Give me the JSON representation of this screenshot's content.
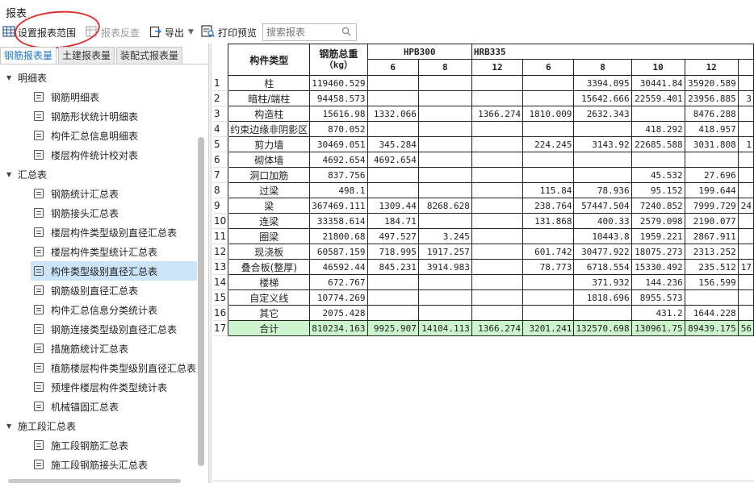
{
  "window": {
    "title": "报表"
  },
  "toolbar": {
    "set_range": "设置报表范围",
    "reverse_check": "报表反查",
    "export": "导出",
    "print_preview": "打印预览",
    "search_placeholder": "搜索报表"
  },
  "tabs": [
    {
      "label": "钢筋报表量"
    },
    {
      "label": "土建报表量"
    },
    {
      "label": "装配式报表量"
    }
  ],
  "tree": {
    "groups": [
      {
        "label": "明细表"
      },
      {
        "label": "汇总表"
      },
      {
        "label": "施工段汇总表"
      }
    ],
    "detail_items": [
      "钢筋明细表",
      "钢筋形状统计明细表",
      "构件汇总信息明细表",
      "楼层构件统计校对表"
    ],
    "summary_items": [
      "钢筋统计汇总表",
      "钢筋接头汇总表",
      "楼层构件类型级别直径汇总表",
      "楼层构件类型统计汇总表",
      "构件类型级别直径汇总表",
      "钢筋级别直径汇总表",
      "构件汇总信息分类统计表",
      "钢筋连接类型级别直径汇总表",
      "措施筋统计汇总表",
      "植筋楼层构件类型级别直径汇总表",
      "预埋件楼层构件类型统计表",
      "机械锚固汇总表"
    ],
    "section_items": [
      "施工段钢筋汇总表",
      "施工段钢筋接头汇总表"
    ],
    "selected": "构件类型级别直径汇总表"
  },
  "table": {
    "headers": {
      "component_type": "构件类型",
      "total_weight": "钢筋总重",
      "total_unit": "（kg）",
      "grade1": "HPB300",
      "grade2": "HRB335",
      "diameters": [
        "6",
        "8",
        "12",
        "6",
        "8",
        "10",
        "12"
      ]
    },
    "rows": [
      {
        "idx": "1",
        "name": "柱",
        "total": "119460.529",
        "cells": [
          "",
          "",
          "",
          "",
          "3394.095",
          "30441.84",
          "35920.589"
        ]
      },
      {
        "idx": "2",
        "name": "暗柱/端柱",
        "total": "94458.573",
        "cells": [
          "",
          "",
          "",
          "",
          "15642.666",
          "22559.401",
          "23956.885"
        ]
      },
      {
        "idx": "3",
        "name": "构造柱",
        "total": "15616.98",
        "cells": [
          "1332.066",
          "",
          "1366.274",
          "1810.009",
          "2632.343",
          "",
          "8476.288"
        ]
      },
      {
        "idx": "4",
        "name": "约束边缘非阴影区",
        "total": "870.052",
        "cells": [
          "",
          "",
          "",
          "",
          "",
          "418.292",
          "418.957"
        ]
      },
      {
        "idx": "5",
        "name": "剪力墙",
        "total": "30469.051",
        "cells": [
          "345.284",
          "",
          "",
          "224.245",
          "3143.92",
          "22685.588",
          "3031.808"
        ]
      },
      {
        "idx": "6",
        "name": "砌体墙",
        "total": "4692.654",
        "cells": [
          "4692.654",
          "",
          "",
          "",
          "",
          "",
          ""
        ]
      },
      {
        "idx": "7",
        "name": "洞口加筋",
        "total": "837.756",
        "cells": [
          "",
          "",
          "",
          "",
          "",
          "45.532",
          "27.696"
        ]
      },
      {
        "idx": "8",
        "name": "过梁",
        "total": "498.1",
        "cells": [
          "",
          "",
          "",
          "115.84",
          "78.936",
          "95.152",
          "199.644"
        ]
      },
      {
        "idx": "9",
        "name": "梁",
        "total": "367469.111",
        "cells": [
          "1309.44",
          "8268.628",
          "",
          "238.764",
          "57447.504",
          "7240.852",
          "7999.729"
        ]
      },
      {
        "idx": "10",
        "name": "连梁",
        "total": "33358.614",
        "cells": [
          "184.71",
          "",
          "",
          "131.868",
          "400.33",
          "2579.098",
          "2190.077"
        ]
      },
      {
        "idx": "11",
        "name": "圈梁",
        "total": "21800.68",
        "cells": [
          "497.527",
          "3.245",
          "",
          "",
          "10443.8",
          "1959.221",
          "2867.911"
        ]
      },
      {
        "idx": "12",
        "name": "现浇板",
        "total": "60587.159",
        "cells": [
          "718.995",
          "1917.257",
          "",
          "601.742",
          "30477.922",
          "18075.273",
          "2313.252"
        ]
      },
      {
        "idx": "13",
        "name": "叠合板(整厚)",
        "total": "46592.44",
        "cells": [
          "845.231",
          "3914.983",
          "",
          "78.773",
          "6718.554",
          "15330.492",
          "235.512"
        ]
      },
      {
        "idx": "14",
        "name": "楼梯",
        "total": "672.767",
        "cells": [
          "",
          "",
          "",
          "",
          "371.932",
          "144.236",
          "156.599"
        ]
      },
      {
        "idx": "15",
        "name": "自定义线",
        "total": "10774.269",
        "cells": [
          "",
          "",
          "",
          "",
          "1818.696",
          "8955.573",
          ""
        ]
      },
      {
        "idx": "16",
        "name": "其它",
        "total": "2075.428",
        "cells": [
          "",
          "",
          "",
          "",
          "",
          "431.2",
          "1644.228"
        ]
      },
      {
        "idx": "17",
        "name": "合计",
        "total": "810234.163",
        "cells": [
          "9925.907",
          "14104.113",
          "1366.274",
          "3201.241",
          "132570.698",
          "130961.75",
          "89439.175"
        ]
      }
    ],
    "overflow_col": [
      "",
      "",
      "3",
      "",
      "",
      "1",
      "",
      "",
      "",
      "24",
      "",
      "",
      "",
      "17",
      "",
      "",
      "",
      "56"
    ]
  }
}
